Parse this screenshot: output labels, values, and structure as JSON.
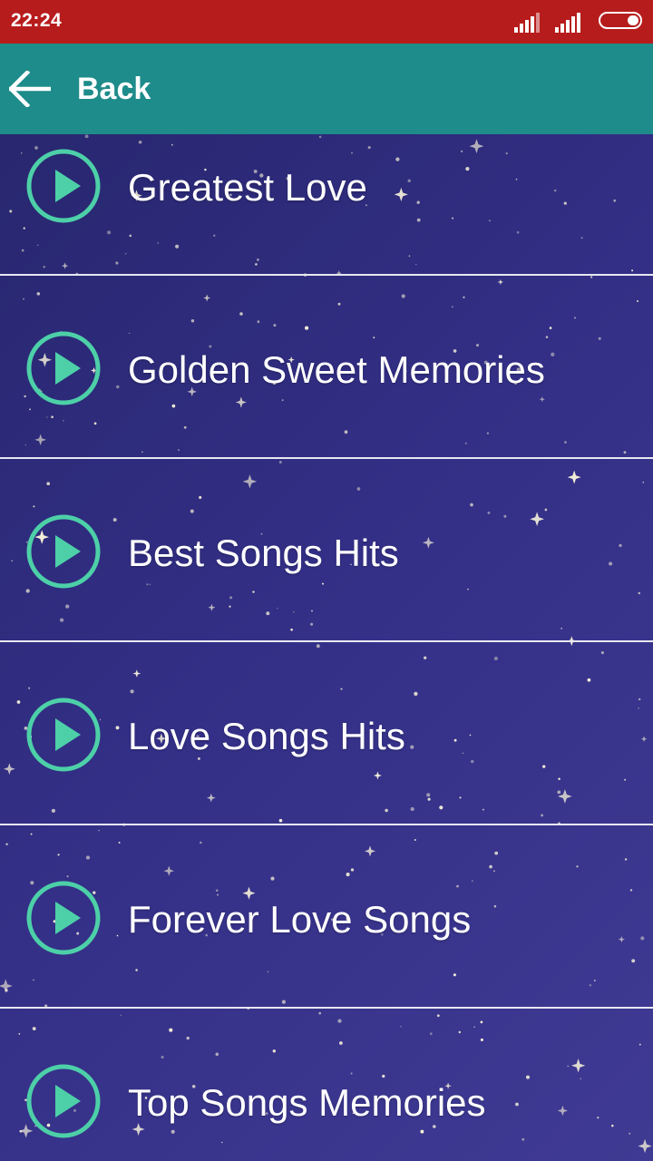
{
  "status_bar": {
    "time": "22:24",
    "icons": [
      "signal-icon",
      "signal-icon",
      "battery-icon"
    ]
  },
  "app_bar": {
    "back_label": "Back",
    "icon": "arrow-left-icon",
    "color": "#1e8c8a"
  },
  "colors": {
    "status_bar": "#b71c1c",
    "play_icon": "#4dd0a8",
    "background": "#2d2a78"
  },
  "songs": [
    {
      "title": "Greatest Love",
      "icon": "play-icon"
    },
    {
      "title": "Golden Sweet Memories",
      "icon": "play-icon"
    },
    {
      "title": "Best Songs Hits",
      "icon": "play-icon"
    },
    {
      "title": "Love Songs Hits",
      "icon": "play-icon"
    },
    {
      "title": "Forever Love Songs",
      "icon": "play-icon"
    },
    {
      "title": "Top Songs Memories",
      "icon": "play-icon"
    }
  ]
}
